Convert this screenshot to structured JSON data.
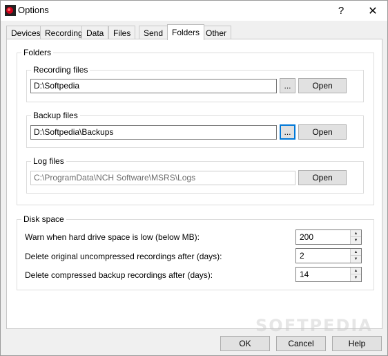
{
  "window": {
    "title": "Options",
    "help_glyph": "?",
    "close_glyph": "✕"
  },
  "tabs": [
    {
      "label": "Devices"
    },
    {
      "label": "Recording"
    },
    {
      "label": "Data"
    },
    {
      "label": "Files"
    },
    {
      "label": "Send"
    },
    {
      "label": "Folders",
      "active": true
    },
    {
      "label": "Other"
    }
  ],
  "folders_group": {
    "label": "Folders",
    "recording": {
      "label": "Recording files",
      "path": "D:\\Softpedia",
      "browse": "...",
      "open": "Open"
    },
    "backup": {
      "label": "Backup files",
      "path": "D:\\Softpedia\\Backups",
      "browse": "...",
      "open": "Open"
    },
    "log": {
      "label": "Log files",
      "path": "C:\\ProgramData\\NCH Software\\MSRS\\Logs",
      "open": "Open"
    }
  },
  "disk_group": {
    "label": "Disk space",
    "rows": [
      {
        "label": "Warn when hard drive space is low (below MB):",
        "value": "200"
      },
      {
        "label": "Delete original uncompressed recordings after (days):",
        "value": "2"
      },
      {
        "label": "Delete compressed backup recordings after (days):",
        "value": "14"
      }
    ]
  },
  "buttons": {
    "ok": "OK",
    "cancel": "Cancel",
    "help": "Help"
  },
  "watermark": "SOFTPEDIA",
  "colors": {
    "focus": "#0078d7",
    "icon_red": "#d0021b"
  }
}
